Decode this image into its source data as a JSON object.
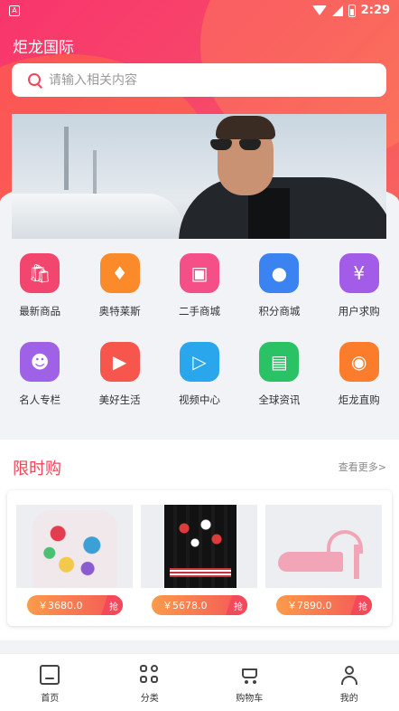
{
  "status": {
    "time": "2:29",
    "battery_level": 0.5
  },
  "header": {
    "title": "炬龙国际"
  },
  "search": {
    "placeholder": "请输入相关内容"
  },
  "categories_row1": [
    {
      "label": "最新商品",
      "icon": "shopping-bag-icon",
      "color": "#f3466f"
    },
    {
      "label": "奥特莱斯",
      "icon": "tag-icon",
      "color": "#fb8b2a"
    },
    {
      "label": "二手商城",
      "icon": "second-hand-icon",
      "color": "#f44f86"
    },
    {
      "label": "积分商城",
      "icon": "coins-icon",
      "color": "#3b83f0"
    },
    {
      "label": "用户求购",
      "icon": "hand-coin-icon",
      "color": "#a35ce8"
    }
  ],
  "categories_row2": [
    {
      "label": "名人专栏",
      "icon": "person-icon",
      "color": "#9f62e6"
    },
    {
      "label": "美好生活",
      "icon": "play-flag-icon",
      "color": "#f7564c"
    },
    {
      "label": "视频中心",
      "icon": "video-icon",
      "color": "#2aa7ec"
    },
    {
      "label": "全球资讯",
      "icon": "monitor-icon",
      "color": "#2bc266"
    },
    {
      "label": "炬龙直购",
      "icon": "camera-icon",
      "color": "#fb7d2b"
    }
  ],
  "flash_sale": {
    "title": "限时购",
    "more": "查看更多>",
    "products": [
      {
        "price": "￥3680.0",
        "action": "抢"
      },
      {
        "price": "￥5678.0",
        "action": "抢"
      },
      {
        "price": "￥7890.0",
        "action": "抢"
      }
    ]
  },
  "tabbar": [
    {
      "label": "首页"
    },
    {
      "label": "分类"
    },
    {
      "label": "购物车"
    },
    {
      "label": "我的"
    }
  ]
}
